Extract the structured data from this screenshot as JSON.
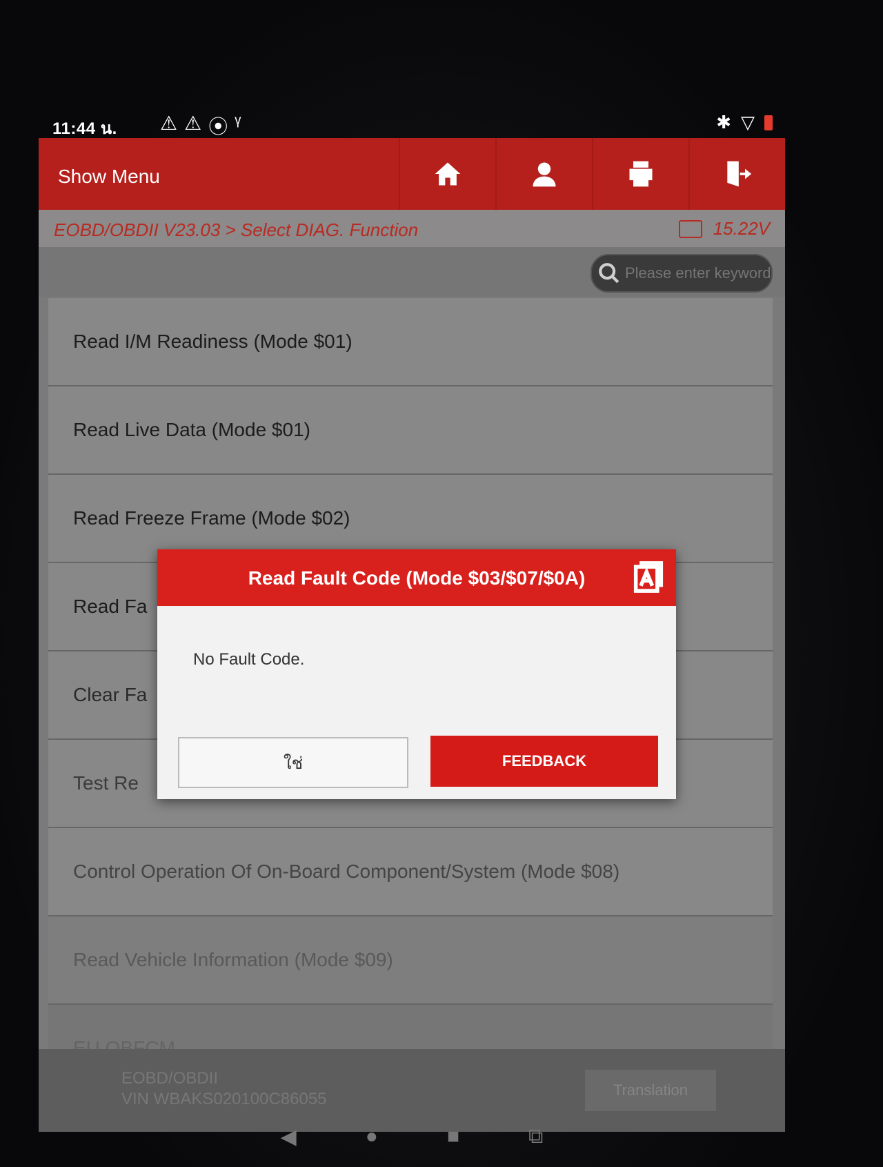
{
  "status_bar": {
    "time": "11:44 น.",
    "left_icons": [
      "warning-icon",
      "warning-icon",
      "bluetooth-circle-icon",
      "usb-icon"
    ],
    "right_icons": [
      "bluetooth-icon",
      "wifi-icon",
      "battery-icon"
    ]
  },
  "header": {
    "show_menu_label": "Show Menu",
    "icons": [
      "home-icon",
      "support-icon",
      "print-icon",
      "exit-icon"
    ]
  },
  "breadcrumb": {
    "path": "EOBD/OBDII V23.03 > Select DIAG. Function",
    "voltage": "15.22V"
  },
  "search": {
    "placeholder": "Please enter keyword"
  },
  "menu": {
    "items": [
      "Read I/M Readiness (Mode $01)",
      "Read Live Data (Mode $01)",
      "Read Freeze Frame (Mode $02)",
      "Read Fa",
      "Clear Fa",
      "Test Re",
      "Control Operation Of On-Board Component/System (Mode $08)",
      "Read Vehicle Information (Mode $09)",
      "EU OBFCM"
    ]
  },
  "footer": {
    "system": "EOBD/OBDII",
    "vin": "VIN WBAKS020100C86055",
    "translation_label": "Translation"
  },
  "dialog": {
    "title": "Read Fault Code (Mode $03/$07/$0A)",
    "message": "No Fault Code.",
    "yes_label": "ใช่",
    "feedback_label": "FEEDBACK"
  },
  "nav": {
    "icons": [
      "back-icon",
      "home-dot-icon",
      "recents-icon",
      "screenshot-icon"
    ]
  }
}
